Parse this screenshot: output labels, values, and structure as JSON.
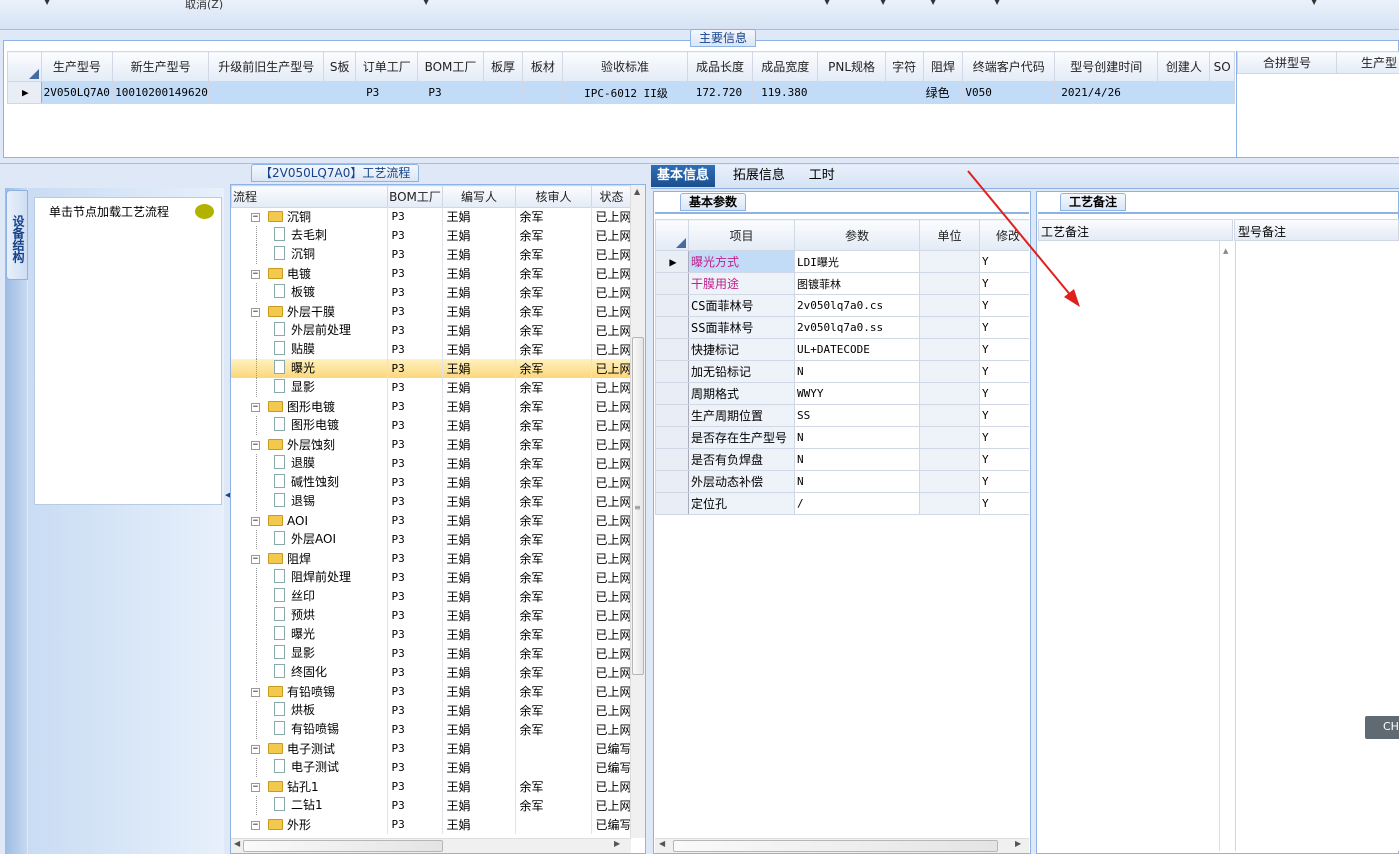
{
  "topbar": {
    "cancel_label": "取消(Z)"
  },
  "main_info": {
    "title": "主要信息",
    "columns": [
      "生产型号",
      "新生产型号",
      "升级前旧生产型号",
      "S板",
      "订单工厂",
      "BOM工厂",
      "板厚",
      "板材",
      "验收标准",
      "成品长度",
      "成品宽度",
      "PNL规格",
      "字符",
      "阻焊",
      "终端客户代码",
      "型号创建时间",
      "创建人",
      "SO"
    ],
    "row": [
      "2V050LQ7A0",
      "10010200149620",
      "",
      "",
      "P3",
      "P3",
      "",
      "",
      "IPC-6012 II级",
      "172.720",
      "119.380",
      "",
      "",
      "绿色",
      "V050",
      "2021/4/26",
      "",
      ""
    ],
    "right_columns": [
      "合拼型号",
      "生产型"
    ]
  },
  "flow_panel": {
    "title": "【2V050LQ7A0】工艺流程",
    "side_tab": "设备结构",
    "hint": "单击节点加载工艺流程",
    "columns": [
      "流程",
      "BOM工厂",
      "编写人",
      "核审人",
      "状态"
    ],
    "rows": [
      {
        "name": "沉铜",
        "level": 0,
        "bom": "P3",
        "writer": "王娟",
        "reviewer": "余军",
        "status": "已上网"
      },
      {
        "name": "去毛刺",
        "level": 1,
        "bom": "P3",
        "writer": "王娟",
        "reviewer": "余军",
        "status": "已上网"
      },
      {
        "name": "沉铜",
        "level": 1,
        "bom": "P3",
        "writer": "王娟",
        "reviewer": "余军",
        "status": "已上网"
      },
      {
        "name": "电镀",
        "level": 0,
        "bom": "P3",
        "writer": "王娟",
        "reviewer": "余军",
        "status": "已上网"
      },
      {
        "name": "板镀",
        "level": 1,
        "bom": "P3",
        "writer": "王娟",
        "reviewer": "余军",
        "status": "已上网"
      },
      {
        "name": "外层干膜",
        "level": 0,
        "bom": "P3",
        "writer": "王娟",
        "reviewer": "余军",
        "status": "已上网"
      },
      {
        "name": "外层前处理",
        "level": 1,
        "bom": "P3",
        "writer": "王娟",
        "reviewer": "余军",
        "status": "已上网"
      },
      {
        "name": "贴膜",
        "level": 1,
        "bom": "P3",
        "writer": "王娟",
        "reviewer": "余军",
        "status": "已上网"
      },
      {
        "name": "曝光",
        "level": 1,
        "bom": "P3",
        "writer": "王娟",
        "reviewer": "余军",
        "status": "已上网",
        "selected": true
      },
      {
        "name": "显影",
        "level": 1,
        "bom": "P3",
        "writer": "王娟",
        "reviewer": "余军",
        "status": "已上网"
      },
      {
        "name": "图形电镀",
        "level": 0,
        "bom": "P3",
        "writer": "王娟",
        "reviewer": "余军",
        "status": "已上网"
      },
      {
        "name": "图形电镀",
        "level": 1,
        "bom": "P3",
        "writer": "王娟",
        "reviewer": "余军",
        "status": "已上网"
      },
      {
        "name": "外层蚀刻",
        "level": 0,
        "bom": "P3",
        "writer": "王娟",
        "reviewer": "余军",
        "status": "已上网"
      },
      {
        "name": "退膜",
        "level": 1,
        "bom": "P3",
        "writer": "王娟",
        "reviewer": "余军",
        "status": "已上网"
      },
      {
        "name": "碱性蚀刻",
        "level": 1,
        "bom": "P3",
        "writer": "王娟",
        "reviewer": "余军",
        "status": "已上网"
      },
      {
        "name": "退锡",
        "level": 1,
        "bom": "P3",
        "writer": "王娟",
        "reviewer": "余军",
        "status": "已上网"
      },
      {
        "name": "AOI",
        "level": 0,
        "bom": "P3",
        "writer": "王娟",
        "reviewer": "余军",
        "status": "已上网"
      },
      {
        "name": "外层AOI",
        "level": 1,
        "bom": "P3",
        "writer": "王娟",
        "reviewer": "余军",
        "status": "已上网"
      },
      {
        "name": "阻焊",
        "level": 0,
        "bom": "P3",
        "writer": "王娟",
        "reviewer": "余军",
        "status": "已上网"
      },
      {
        "name": "阻焊前处理",
        "level": 1,
        "bom": "P3",
        "writer": "王娟",
        "reviewer": "余军",
        "status": "已上网"
      },
      {
        "name": "丝印",
        "level": 1,
        "bom": "P3",
        "writer": "王娟",
        "reviewer": "余军",
        "status": "已上网"
      },
      {
        "name": "预烘",
        "level": 1,
        "bom": "P3",
        "writer": "王娟",
        "reviewer": "余军",
        "status": "已上网"
      },
      {
        "name": "曝光",
        "level": 1,
        "bom": "P3",
        "writer": "王娟",
        "reviewer": "余军",
        "status": "已上网"
      },
      {
        "name": "显影",
        "level": 1,
        "bom": "P3",
        "writer": "王娟",
        "reviewer": "余军",
        "status": "已上网"
      },
      {
        "name": "终固化",
        "level": 1,
        "bom": "P3",
        "writer": "王娟",
        "reviewer": "余军",
        "status": "已上网"
      },
      {
        "name": "有铅喷锡",
        "level": 0,
        "bom": "P3",
        "writer": "王娟",
        "reviewer": "余军",
        "status": "已上网"
      },
      {
        "name": "烘板",
        "level": 1,
        "bom": "P3",
        "writer": "王娟",
        "reviewer": "余军",
        "status": "已上网"
      },
      {
        "name": "有铅喷锡",
        "level": 1,
        "bom": "P3",
        "writer": "王娟",
        "reviewer": "余军",
        "status": "已上网"
      },
      {
        "name": "电子测试",
        "level": 0,
        "bom": "P3",
        "writer": "王娟",
        "reviewer": "",
        "status": "已编写"
      },
      {
        "name": "电子测试",
        "level": 1,
        "bom": "P3",
        "writer": "王娟",
        "reviewer": "",
        "status": "已编写"
      },
      {
        "name": "钻孔1",
        "level": 0,
        "bom": "P3",
        "writer": "王娟",
        "reviewer": "余军",
        "status": "已上网"
      },
      {
        "name": "二钻1",
        "level": 1,
        "bom": "P3",
        "writer": "王娟",
        "reviewer": "余军",
        "status": "已上网"
      },
      {
        "name": "外形",
        "level": 0,
        "bom": "P3",
        "writer": "王娟",
        "reviewer": "",
        "status": "已编写"
      }
    ]
  },
  "tabs": [
    "基本信息",
    "拓展信息",
    "工时"
  ],
  "basic_params": {
    "title": "基本参数",
    "columns": [
      "项目",
      "参数",
      "单位",
      "修改"
    ],
    "rows": [
      {
        "item": "曝光方式",
        "value": "LDI曝光",
        "unit": "",
        "mod": "Y",
        "pink": true
      },
      {
        "item": "干膜用途",
        "value": "图镀菲林",
        "unit": "",
        "mod": "Y",
        "pink": true
      },
      {
        "item": "CS面菲林号",
        "value": "2v050lq7a0.cs",
        "unit": "",
        "mod": "Y"
      },
      {
        "item": "SS面菲林号",
        "value": "2v050lq7a0.ss",
        "unit": "",
        "mod": "Y"
      },
      {
        "item": "快捷标记",
        "value": "UL+DATECODE",
        "unit": "",
        "mod": "Y"
      },
      {
        "item": "加无铅标记",
        "value": "N",
        "unit": "",
        "mod": "Y"
      },
      {
        "item": "周期格式",
        "value": "WWYY",
        "unit": "",
        "mod": "Y"
      },
      {
        "item": "生产周期位置",
        "value": "SS",
        "unit": "",
        "mod": "Y"
      },
      {
        "item": "是否存在生产型号",
        "value": "N",
        "unit": "",
        "mod": "Y"
      },
      {
        "item": "是否有负焊盘",
        "value": "N",
        "unit": "",
        "mod": "Y"
      },
      {
        "item": "外层动态补偿",
        "value": "N",
        "unit": "",
        "mod": "Y"
      },
      {
        "item": "定位孔",
        "value": "/",
        "unit": "",
        "mod": "Y"
      }
    ]
  },
  "remarks": {
    "title": "工艺备注",
    "col1": "工艺备注",
    "col2": "型号备注",
    "side_btn": "CH"
  }
}
